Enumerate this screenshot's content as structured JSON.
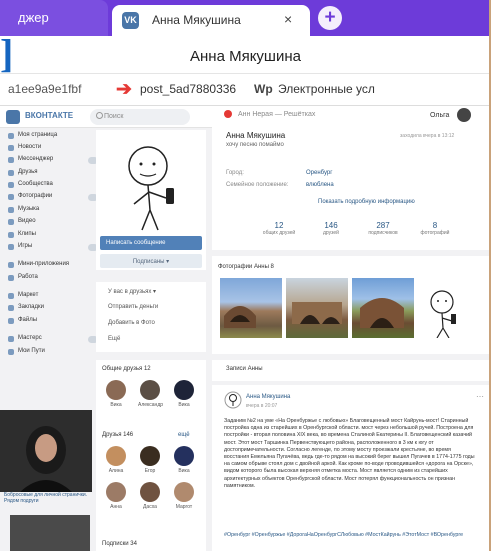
{
  "browser": {
    "tab_left_label": "джер",
    "active_tab_title": "Анна Мякушина",
    "tab_close_glyph": "×",
    "new_tab_glyph": "+",
    "window_title": "Анна Мякушина",
    "bracket_glyph": "]",
    "bookmarks": {
      "hash": "a1ee9a9e1fbf",
      "post": "post_5ad7880336",
      "ext_icon": "Wp",
      "ext": "Электронные усл"
    }
  },
  "vk": {
    "brand": "ВКОНТАКТЕ",
    "search_placeholder": "Поиск",
    "player_text": "Анн Нерая — Решётках",
    "user_name": "Ольга",
    "menu": [
      "Моя страница",
      "Новости",
      "Мессенджер",
      "Друзья",
      "Сообщества",
      "Фотографии",
      "Музыка",
      "Видео",
      "Клипы",
      "Игры",
      "Мини-приложения",
      "Работа",
      "Маркет",
      "Закладки",
      "Файлы",
      "Мастерс",
      "Мои Пути"
    ],
    "profile": {
      "name": "Анна Мякушина",
      "status": "хочу песню помаймо",
      "online": "заходила вчера в 13:12",
      "rows": [
        {
          "label": "Город:",
          "value": "Оренбург"
        },
        {
          "label": "Семейное положение:",
          "value": "влюблена"
        }
      ],
      "more": "Показать подробную информацию",
      "counters": [
        {
          "n": "12",
          "l": "общих друзей"
        },
        {
          "n": "146",
          "l": "друзей"
        },
        {
          "n": "287",
          "l": "подписчиков"
        },
        {
          "n": "8",
          "l": "фотографий"
        }
      ]
    },
    "buttons": {
      "message": "Написать сообщение",
      "subscribe": "Подписаны ▾"
    },
    "actions": [
      "У вас в друзьях ▾",
      "Отправить деньги",
      "Добавить в Фото",
      "Ещё"
    ],
    "friends": {
      "common_title": "Общие друзья 12",
      "common": [
        "Вика",
        "Александр",
        "Вика"
      ],
      "all_title": "Друзья 146",
      "all_more": "ещё",
      "all": [
        "Алина",
        "Егор",
        "Вика",
        "Анна",
        "Дасха",
        "Маргот"
      ],
      "subs_title": "Подписки 34"
    },
    "photos_title": "Фотографии Анны  8",
    "wall_title": "Записи Анны",
    "post": {
      "author": "Анна Мякушина",
      "date": "вчера в 20:07",
      "body": "Заданим №2 на уме «На Оренбуржье с любовью» Благовещенный мост Кайрунь-мост! Старинный постройка одна из старейших в Оренбургской области. мост через небольшой ручей. Построена для постройки - вторая половина XIX века, во времена Сталиной Екатерины II. Благовещенский казачий мост. Этот мост Таршинка Первенствующего района, расположенного в 3 км к югу от достопримечательности. Согласно легенде, по этому мосту проезжали крестьяне, во время восстания Емельяна Пугачёва, ведь где-то рядом на высокий берег вышел Пугачев в 1774-1775 годы на самом обрыве стоял дом с двойной аркой. Как кроме по-воде проводившейся «дорога на Орске», видом которого была высокая верхняя отметка моста. Мост является одним из старейших архитектурных объектов Оренбургской области. Мост потерял функциональность он признан памятником.",
      "tags": "#Оренбург #Оренбуржье #ДорогаНаОренбургСЛюбовью #МостКайрунь #ЭтотМост #ВОренбурге"
    },
    "left_caption": "Бобросовые для личной странички. Рядом подруги"
  },
  "colors": {
    "tab_purple": "#6d3bd9",
    "vk_blue": "#4a76a8",
    "link_blue": "#2a5885",
    "bracket_blue": "#1565c0",
    "arrow_red": "#e53935"
  }
}
